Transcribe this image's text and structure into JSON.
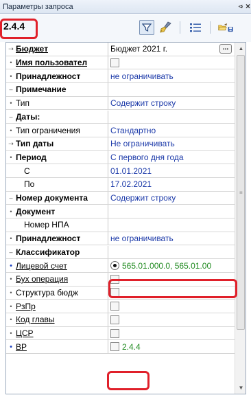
{
  "window": {
    "title": "Параметры запроса",
    "pin_glyph": "⩹",
    "close_glyph": "×"
  },
  "toolbar": {
    "code": "2.4.4",
    "icons": [
      "filter-icon",
      "brush-icon",
      "list-icon",
      "open-save-icon"
    ]
  },
  "rows": [
    {
      "marker": "⇢",
      "name": "Бюджет",
      "style": "bold-underline",
      "value": "Бюджет 2021 г.",
      "value_style": "black",
      "control": "ellipsis",
      "control_label": "..."
    },
    {
      "marker": "•",
      "name": "Имя пользовател",
      "style": "bold-underline",
      "value": "",
      "control": "checkbox"
    },
    {
      "marker": "•",
      "name": "Принадлежност",
      "style": "bold",
      "value": "не ограничивать",
      "value_style": "blue"
    },
    {
      "marker": "–",
      "name": "Примечание",
      "style": "category",
      "value": ""
    },
    {
      "marker": "•",
      "name": "Тип",
      "style": "normal",
      "value": "Содержит строку",
      "value_style": "blue"
    },
    {
      "marker": "–",
      "name": "Даты:",
      "style": "category",
      "value": ""
    },
    {
      "marker": "•",
      "name": "Тип ограничения",
      "style": "normal",
      "value": "Стандартно",
      "value_style": "blue"
    },
    {
      "marker": "⇢",
      "name": "Тип даты",
      "style": "bold",
      "value": "Не ограничивать",
      "value_style": "blue"
    },
    {
      "marker": "•",
      "name": "Период",
      "style": "bold",
      "value": "С первого дня года",
      "value_style": "blue"
    },
    {
      "marker": "",
      "name": "С",
      "style": "indent",
      "value": "01.01.2021",
      "value_style": "blue"
    },
    {
      "marker": "",
      "name": "По",
      "style": "indent",
      "value": "17.02.2021",
      "value_style": "blue"
    },
    {
      "marker": "–",
      "name": "Номер документа",
      "style": "category",
      "value": "Содержит строку",
      "value_style": "blue"
    },
    {
      "marker": "•",
      "name": "Документ",
      "style": "bold",
      "value": ""
    },
    {
      "marker": "",
      "name": "Номер НПА",
      "style": "indent",
      "value": ""
    },
    {
      "marker": "•",
      "name": "Принадлежност",
      "style": "bold",
      "value": "не ограничивать",
      "value_style": "blue"
    },
    {
      "marker": "–",
      "name": "Классификатор",
      "style": "category",
      "value": ""
    },
    {
      "marker": "•",
      "name": "Лицевой счет",
      "style": "underline",
      "marker_color": "blue",
      "value": "565.01.000.0, 565.01.00",
      "value_style": "green",
      "control": "radio"
    },
    {
      "marker": "•",
      "name": "Бух операция",
      "style": "underline",
      "value": "",
      "control": "checkbox"
    },
    {
      "marker": "•",
      "name": "Структура бюдж",
      "style": "normal",
      "value": "",
      "control": "checkbox"
    },
    {
      "marker": "•",
      "name": "РзПр",
      "style": "underline",
      "value": "",
      "control": "checkbox"
    },
    {
      "marker": "•",
      "name": "Код главы",
      "style": "underline",
      "value": "",
      "control": "checkbox"
    },
    {
      "marker": "•",
      "name": "ЦСР",
      "style": "underline",
      "value": "",
      "control": "checkbox"
    },
    {
      "marker": "•",
      "name": "ВР",
      "style": "underline",
      "marker_color": "blue",
      "value": "2.4.4",
      "value_style": "green",
      "control": "checkbox"
    }
  ],
  "scrollbar": {
    "up": "▲",
    "down": "▼",
    "grip": "≡"
  },
  "colors": {
    "annotation": "#e0202a",
    "link_blue": "#1c3aa9",
    "value_green": "#1f8a1f"
  }
}
